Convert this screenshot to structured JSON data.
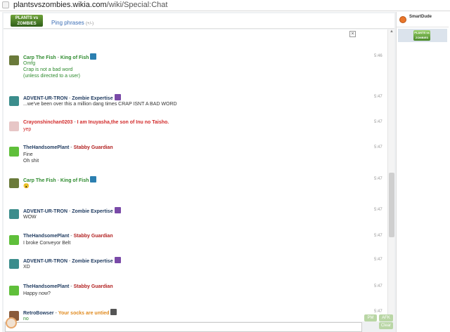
{
  "browser": {
    "url_host": "plantsvszombies.wikia.com",
    "url_path": "/wiki/Special:Chat"
  },
  "header": {
    "logo_text": "PLANTS vs ZOMBIES",
    "ping_label": "Ping phrases",
    "ping_count": "(+/-)"
  },
  "close_label": "×",
  "messages": [
    {
      "name": "Carp The Fish",
      "sep": " - ",
      "title": "King of Fish",
      "name_color": "#2e8b2e",
      "title_color": "#2e8b2e",
      "text_color": "#2e8b2e",
      "avatar_color": "#6a7a3a",
      "badge_color": "#2b7fb0",
      "time": "5:46",
      "lines": [
        "Omfg",
        "Crap is not a bad word",
        "(unless directed to a user)"
      ]
    },
    {
      "name": "ADVENT-UR-TRON",
      "sep": " - ",
      "title": "Zombie Expertise",
      "name_color": "#1e3a5f",
      "title_color": "#1e3a5f",
      "text_color": "#333333",
      "avatar_color": "#3b8d8c",
      "badge_color": "#7a4aa8",
      "time": "5:47",
      "lines": [
        "...we've been over this a million dang times CRAP ISNT A BAD WORD"
      ]
    },
    {
      "name": "Crayonshinchan0203",
      "sep": " - ",
      "title": "I am Inuyasha,the son of Inu no Taisho.",
      "name_color": "#d22b2b",
      "title_color": "#d22b2b",
      "text_color": "#d22b2b",
      "avatar_color": "#e7c6c6",
      "badge_color": "",
      "time": "5:47",
      "lines": [
        "yep"
      ]
    },
    {
      "name": "TheHandsomePlant",
      "sep": " - ",
      "title": "Stabby Guardian",
      "name_color": "#1e3a5f",
      "title_color": "#b22222",
      "text_color": "#333333",
      "avatar_color": "#5fbf3a",
      "badge_color": "",
      "time": "5:47",
      "lines": [
        "Fine",
        "Oh shit"
      ]
    },
    {
      "name": "Carp The Fish",
      "sep": " - ",
      "title": "King of Fish",
      "name_color": "#2e8b2e",
      "title_color": "#2e8b2e",
      "text_color": "#2e8b2e",
      "avatar_color": "#6a7a3a",
      "badge_color": "#2b7fb0",
      "time": "5:47",
      "lines": [
        "😮"
      ]
    },
    {
      "name": "ADVENT-UR-TRON",
      "sep": " - ",
      "title": "Zombie Expertise",
      "name_color": "#1e3a5f",
      "title_color": "#1e3a5f",
      "text_color": "#333333",
      "avatar_color": "#3b8d8c",
      "badge_color": "#7a4aa8",
      "time": "5:47",
      "lines": [
        "WOW"
      ]
    },
    {
      "name": "TheHandsomePlant",
      "sep": " - ",
      "title": "Stabby Guardian",
      "name_color": "#1e3a5f",
      "title_color": "#b22222",
      "text_color": "#333333",
      "avatar_color": "#5fbf3a",
      "badge_color": "",
      "time": "5:47",
      "lines": [
        "I broke Conveyor Belt"
      ]
    },
    {
      "name": "ADVENT-UR-TRON",
      "sep": " - ",
      "title": "Zombie Expertise",
      "name_color": "#1e3a5f",
      "title_color": "#1e3a5f",
      "text_color": "#333333",
      "avatar_color": "#3b8d8c",
      "badge_color": "#7a4aa8",
      "time": "5:47",
      "lines": [
        "XD"
      ]
    },
    {
      "name": "TheHandsomePlant",
      "sep": " - ",
      "title": "Stabby Guardian",
      "name_color": "#1e3a5f",
      "title_color": "#b22222",
      "text_color": "#333333",
      "avatar_color": "#5fbf3a",
      "badge_color": "",
      "time": "5:47",
      "lines": [
        "Happy now?"
      ]
    },
    {
      "name": "RetroBowser",
      "sep": " - ",
      "title": "Your socks are untied",
      "name_color": "#1e3a5f",
      "title_color": "#e08a1e",
      "text_color": "#2e8b2e",
      "avatar_color": "#8a5a3a",
      "badge_color": "#555555",
      "time": "5:47",
      "lines": [
        "no"
      ]
    }
  ],
  "buttons": {
    "pm": "PM",
    "afk": "AFK",
    "clear": "Clear"
  },
  "user_panel": {
    "current_user": "SmartDude",
    "room_logo_text": "PLANTS vs ZOMBIES"
  },
  "scroll": {
    "up": "▲",
    "down": "▼"
  }
}
